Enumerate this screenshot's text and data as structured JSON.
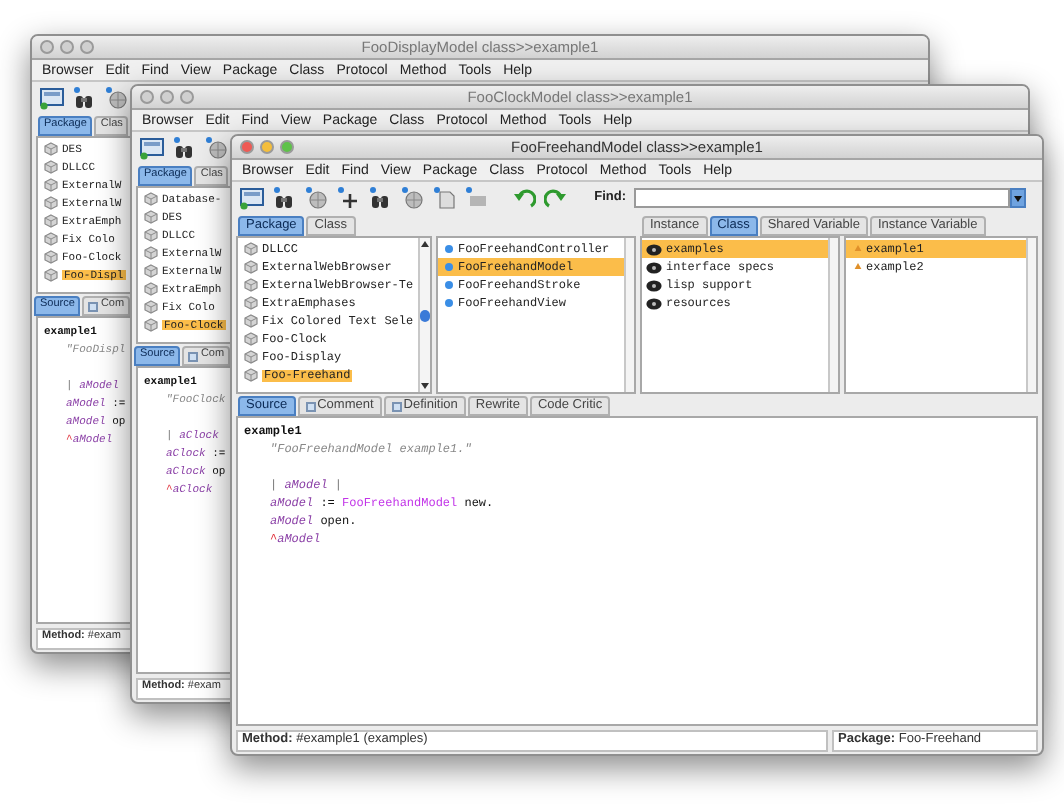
{
  "windows": [
    {
      "title": "FooDisplayModel class>>example1",
      "active": false,
      "menu": [
        "Browser",
        "Edit",
        "Find",
        "View",
        "Package",
        "Class",
        "Protocol",
        "Method",
        "Tools",
        "Help"
      ],
      "toolbar": [
        {
          "kind": "browser"
        },
        {
          "kind": "binoculars"
        },
        {
          "kind": "globe"
        }
      ],
      "package_tabs": [
        {
          "label": "Package",
          "selected": true
        },
        {
          "label": "Clas",
          "selected": false
        }
      ],
      "packages": [
        {
          "name": "DES",
          "selected": false
        },
        {
          "name": "DLLCC",
          "selected": false
        },
        {
          "name": "ExternalW",
          "selected": false
        },
        {
          "name": "ExternalW",
          "selected": false
        },
        {
          "name": "ExtraEmph",
          "selected": false
        },
        {
          "name": "Fix Colo",
          "selected": false
        },
        {
          "name": "Foo-Clock",
          "selected": false
        },
        {
          "name": "Foo-Displ",
          "selected": true
        }
      ],
      "source_tabs": [
        {
          "label": "Source",
          "selected": true,
          "kind": "plain"
        },
        {
          "label": "Com",
          "selected": false,
          "kind": "doc"
        }
      ],
      "code": [
        {
          "kind": "header",
          "segments": [
            {
              "kind": "plain",
              "text": "example1"
            }
          ]
        },
        {
          "kind": "body",
          "segments": [
            {
              "kind": "comment",
              "text": "\"FooDispl"
            }
          ]
        },
        {
          "kind": "blank"
        },
        {
          "kind": "body",
          "segments": [
            {
              "kind": "punct",
              "text": "| "
            },
            {
              "kind": "variable",
              "text": "aModel"
            }
          ]
        },
        {
          "kind": "body",
          "segments": [
            {
              "kind": "variable",
              "text": "aModel"
            },
            {
              "kind": "plain",
              "text": " :="
            }
          ]
        },
        {
          "kind": "body",
          "segments": [
            {
              "kind": "variable",
              "text": "aModel"
            },
            {
              "kind": "plain",
              "text": " op"
            }
          ]
        },
        {
          "kind": "body",
          "segments": [
            {
              "kind": "return",
              "text": "^"
            },
            {
              "kind": "variable",
              "text": "aModel"
            }
          ]
        }
      ],
      "status": [
        "**Method:** #exam"
      ]
    },
    {
      "title": "FooClockModel class>>example1",
      "active": false,
      "menu": [
        "Browser",
        "Edit",
        "Find",
        "View",
        "Package",
        "Class",
        "Protocol",
        "Method",
        "Tools",
        "Help"
      ],
      "toolbar": [
        {
          "kind": "browser"
        },
        {
          "kind": "binoculars"
        },
        {
          "kind": "globe"
        }
      ],
      "package_tabs": [
        {
          "label": "Package",
          "selected": true
        },
        {
          "label": "Clas",
          "selected": false
        }
      ],
      "packages": [
        {
          "name": "Database-",
          "selected": false
        },
        {
          "name": "DES",
          "selected": false
        },
        {
          "name": "DLLCC",
          "selected": false
        },
        {
          "name": "ExternalW",
          "selected": false
        },
        {
          "name": "ExternalW",
          "selected": false
        },
        {
          "name": "ExtraEmph",
          "selected": false
        },
        {
          "name": "Fix Colo",
          "selected": false
        },
        {
          "name": "Foo-Clock",
          "selected": true
        }
      ],
      "source_tabs": [
        {
          "label": "Source",
          "selected": true,
          "kind": "plain"
        },
        {
          "label": "Com",
          "selected": false,
          "kind": "doc"
        }
      ],
      "code": [
        {
          "kind": "header",
          "segments": [
            {
              "kind": "plain",
              "text": "example1"
            }
          ]
        },
        {
          "kind": "body",
          "segments": [
            {
              "kind": "comment",
              "text": "\"FooClock"
            }
          ]
        },
        {
          "kind": "blank"
        },
        {
          "kind": "body",
          "segments": [
            {
              "kind": "punct",
              "text": "| "
            },
            {
              "kind": "variable",
              "text": "aClock"
            }
          ]
        },
        {
          "kind": "body",
          "segments": [
            {
              "kind": "variable",
              "text": "aClock"
            },
            {
              "kind": "plain",
              "text": " :="
            }
          ]
        },
        {
          "kind": "body",
          "segments": [
            {
              "kind": "variable",
              "text": "aClock"
            },
            {
              "kind": "plain",
              "text": " op"
            }
          ]
        },
        {
          "kind": "body",
          "segments": [
            {
              "kind": "return",
              "text": "^"
            },
            {
              "kind": "variable",
              "text": "aClock"
            }
          ]
        }
      ],
      "status": [
        "**Method:** #exam"
      ]
    },
    {
      "title": "FooFreehandModel class>>example1",
      "active": true,
      "menu": [
        "Browser",
        "Edit",
        "Find",
        "View",
        "Package",
        "Class",
        "Protocol",
        "Method",
        "Tools",
        "Help"
      ],
      "toolbar": [
        {
          "kind": "browser"
        },
        {
          "kind": "binoculars"
        },
        {
          "kind": "globe"
        },
        {
          "kind": "plus"
        },
        {
          "kind": "binoculars"
        },
        {
          "kind": "globe"
        },
        {
          "kind": "document"
        },
        {
          "kind": "bar"
        },
        {
          "kind": "undo"
        },
        {
          "kind": "redo"
        }
      ],
      "find_label": "Find:",
      "package_tabs": [
        {
          "label": "Package",
          "selected": true
        },
        {
          "label": "Class",
          "selected": false
        }
      ],
      "packages": [
        {
          "name": "DLLCC",
          "selected": false
        },
        {
          "name": "ExternalWebBrowser",
          "selected": false
        },
        {
          "name": "ExternalWebBrowser-Te",
          "selected": false
        },
        {
          "name": "ExtraEmphases",
          "selected": false
        },
        {
          "name": "Fix Colored Text Sele",
          "selected": false
        },
        {
          "name": "Foo-Clock",
          "selected": false
        },
        {
          "name": "Foo-Display",
          "selected": false
        },
        {
          "name": "Foo-Freehand",
          "selected": true
        }
      ],
      "classes": [
        {
          "name": "FooFreehandController",
          "selected": false
        },
        {
          "name": "FooFreehandModel",
          "selected": true
        },
        {
          "name": "FooFreehandStroke",
          "selected": false
        },
        {
          "name": "FooFreehandView",
          "selected": false
        }
      ],
      "side_tabs": [
        {
          "label": "Instance",
          "selected": false
        },
        {
          "label": "Class",
          "selected": true
        },
        {
          "label": "Shared Variable",
          "selected": false
        },
        {
          "label": "Instance Variable",
          "selected": false
        }
      ],
      "protocols": [
        {
          "name": "examples",
          "selected": true
        },
        {
          "name": "interface specs",
          "selected": false
        },
        {
          "name": "lisp support",
          "selected": false
        },
        {
          "name": "resources",
          "selected": false
        }
      ],
      "methods": [
        {
          "name": "example1",
          "selected": true
        },
        {
          "name": "example2",
          "selected": false
        }
      ],
      "source_tabs": [
        {
          "label": "Source",
          "selected": true,
          "kind": "plain"
        },
        {
          "label": "Comment",
          "selected": false,
          "kind": "doc"
        },
        {
          "label": "Definition",
          "selected": false,
          "kind": "doc"
        },
        {
          "label": "Rewrite",
          "selected": false,
          "kind": "plain"
        },
        {
          "label": "Code Critic",
          "selected": false,
          "kind": "plain"
        }
      ],
      "code": [
        {
          "kind": "header",
          "segments": [
            {
              "kind": "plain",
              "text": "example1"
            }
          ]
        },
        {
          "kind": "body",
          "segments": [
            {
              "kind": "comment",
              "text": "\"FooFreehandModel example1.\""
            }
          ]
        },
        {
          "kind": "blank"
        },
        {
          "kind": "body",
          "segments": [
            {
              "kind": "punct",
              "text": "| "
            },
            {
              "kind": "variable",
              "text": "aModel"
            },
            {
              "kind": "punct",
              "text": " |"
            }
          ]
        },
        {
          "kind": "body",
          "segments": [
            {
              "kind": "variable",
              "text": "aModel"
            },
            {
              "kind": "plain",
              "text": " := "
            },
            {
              "kind": "class",
              "text": "FooFreehandModel"
            },
            {
              "kind": "plain",
              "text": " new."
            }
          ]
        },
        {
          "kind": "body",
          "segments": [
            {
              "kind": "variable",
              "text": "aModel"
            },
            {
              "kind": "plain",
              "text": " open."
            }
          ]
        },
        {
          "kind": "body",
          "segments": [
            {
              "kind": "return",
              "text": "^"
            },
            {
              "kind": "variable",
              "text": "aModel"
            }
          ]
        }
      ],
      "status": [
        "**Method:** #example1 (examples)",
        "**Package:** Foo-Freehand"
      ]
    }
  ]
}
